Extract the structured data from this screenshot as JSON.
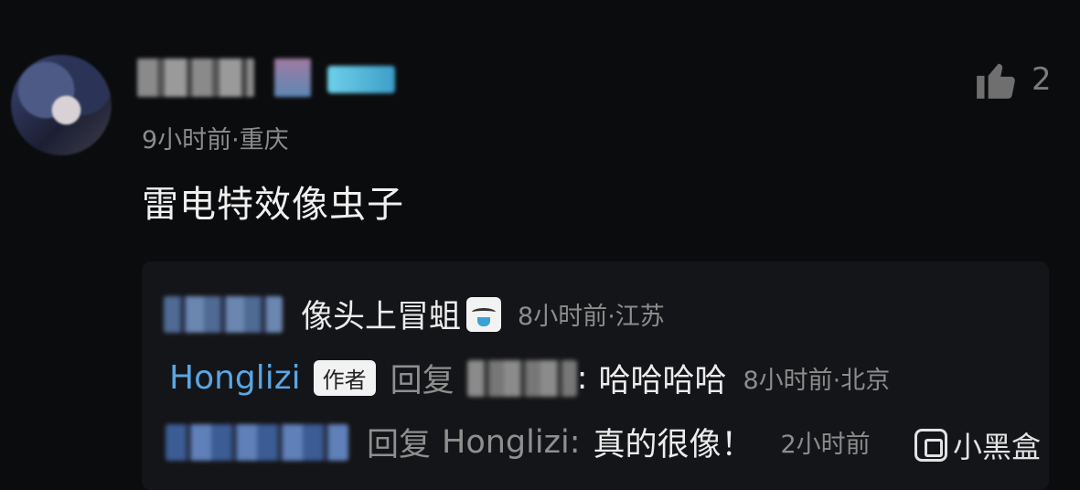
{
  "comment": {
    "avatar_icon": "user-avatar",
    "time_location": "9小时前·重庆",
    "text": "雷电特效像虫子",
    "like_icon": "thumbs-up-icon",
    "like_count": "2"
  },
  "replies": [
    {
      "text": "像头上冒蛆",
      "sticker_icon": "crying-emoji-sticker",
      "meta": "8小时前·江苏"
    },
    {
      "author": "Honglizi",
      "badge": "作者",
      "reply_word": "回复",
      "text": "哈哈哈哈",
      "meta": "8小时前·北京"
    },
    {
      "reply_word": "回复",
      "target": "Honglizi:",
      "text": "真的很像！",
      "meta": "2小时前"
    }
  ],
  "watermark": {
    "text": "小黑盒",
    "logo_icon": "heybox-logo-icon"
  },
  "colors": {
    "background": "#0b0c0e",
    "reply_panel": "#141518",
    "author_name": "#5aa6e4",
    "meta_text": "#8c8c8c"
  }
}
